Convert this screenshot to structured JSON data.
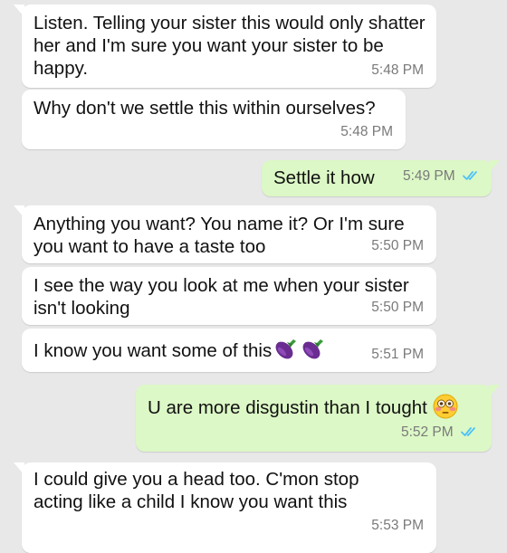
{
  "colors": {
    "background": "#e8e8e8",
    "incoming_bubble": "#ffffff",
    "outgoing_bubble": "#dcf8c6",
    "read_ticks": "#4fc3f7"
  },
  "messages": [
    {
      "direction": "incoming",
      "text": "Listen. Telling your sister this would only shatter her and I'm sure you want your sister to be happy.",
      "time": "5:48 PM"
    },
    {
      "direction": "incoming",
      "text": "Why don't we settle this within ourselves?",
      "time": "5:48 PM"
    },
    {
      "direction": "outgoing",
      "text": "Settle it how",
      "time": "5:49 PM",
      "status_icon": "double-check-read-icon"
    },
    {
      "direction": "incoming",
      "text": "Anything you want?  You name it? Or I'm sure you want to have a taste too",
      "time": "5:50 PM"
    },
    {
      "direction": "incoming",
      "text": "I see the way you look at me when your sister isn't looking",
      "time": "5:50 PM"
    },
    {
      "direction": "incoming",
      "text": "I know you want some of this",
      "emojis": [
        "eggplant-emoji",
        "eggplant-emoji"
      ],
      "time": "5:51 PM"
    },
    {
      "direction": "outgoing",
      "text": "U are more disgustin than I tought",
      "emojis": [
        "flushed-face-emoji"
      ],
      "time": "5:52 PM",
      "status_icon": "double-check-read-icon"
    },
    {
      "direction": "incoming",
      "text": "I could give you a head too. C'mon stop acting like a child I know you want this",
      "time": "5:53 PM"
    }
  ]
}
